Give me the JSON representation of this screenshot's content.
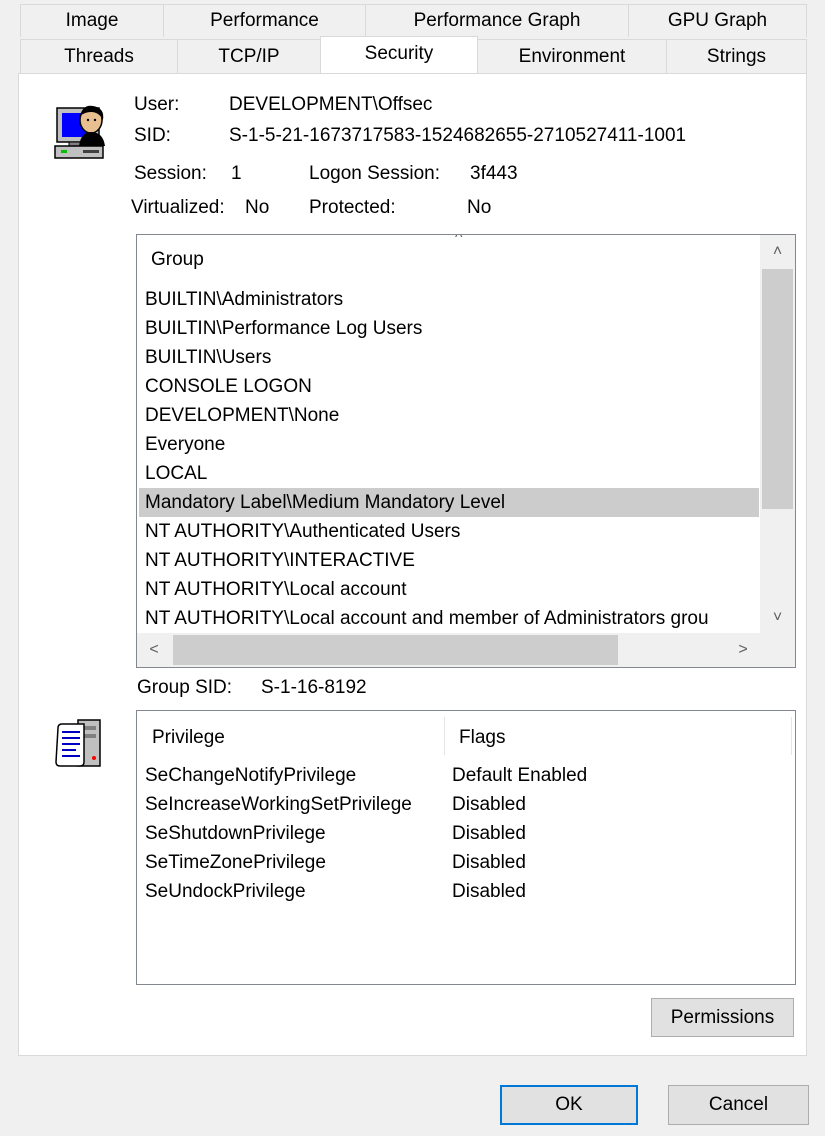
{
  "tabs_back_row": [
    "Image",
    "Performance",
    "Performance Graph",
    "GPU Graph"
  ],
  "tabs_front_row": [
    "Threads",
    "TCP/IP",
    "Security",
    "Environment",
    "Strings"
  ],
  "user_info": {
    "user_label": "User:",
    "user_value": "DEVELOPMENT\\Offsec",
    "sid_label": "SID:",
    "sid_value": "S-1-5-21-1673717583-1524682655-2710527411-1001",
    "session_label": "Session:",
    "session_value": "1",
    "logon_session_label": "Logon Session:",
    "logon_session_value": "3f443",
    "virtualized_label": "Virtualized:",
    "virtualized_value": "No",
    "protected_label": "Protected:",
    "protected_value": "No"
  },
  "groups": {
    "column_header": "Group",
    "items": [
      "BUILTIN\\Administrators",
      "BUILTIN\\Performance Log Users",
      "BUILTIN\\Users",
      "CONSOLE LOGON",
      "DEVELOPMENT\\None",
      "Everyone",
      "LOCAL",
      "Mandatory Label\\Medium Mandatory Level",
      "NT AUTHORITY\\Authenticated Users",
      "NT AUTHORITY\\INTERACTIVE",
      "NT AUTHORITY\\Local account",
      "NT AUTHORITY\\Local account and member of Administrators grou"
    ],
    "selected_item": "Mandatory Label\\Medium Mandatory Level"
  },
  "group_sid": {
    "label": "Group SID:",
    "value": "S-1-16-8192"
  },
  "privileges": {
    "column_privilege": "Privilege",
    "column_flags": "Flags",
    "rows": [
      {
        "name": "SeChangeNotifyPrivilege",
        "flags": "Default Enabled"
      },
      {
        "name": "SeIncreaseWorkingSetPrivilege",
        "flags": "Disabled"
      },
      {
        "name": "SeShutdownPrivilege",
        "flags": "Disabled"
      },
      {
        "name": "SeTimeZonePrivilege",
        "flags": "Disabled"
      },
      {
        "name": "SeUndockPrivilege",
        "flags": "Disabled"
      }
    ]
  },
  "buttons": {
    "permissions": "Permissions",
    "ok": "OK",
    "cancel": "Cancel"
  },
  "icons": {
    "user_icon": "user-computer-icon",
    "privilege_icon": "privilege-scroll-server-icon"
  },
  "colors": {
    "selection": "#cccccc",
    "default_button_border": "#0078d7",
    "window_bg": "#f0f0f0"
  }
}
